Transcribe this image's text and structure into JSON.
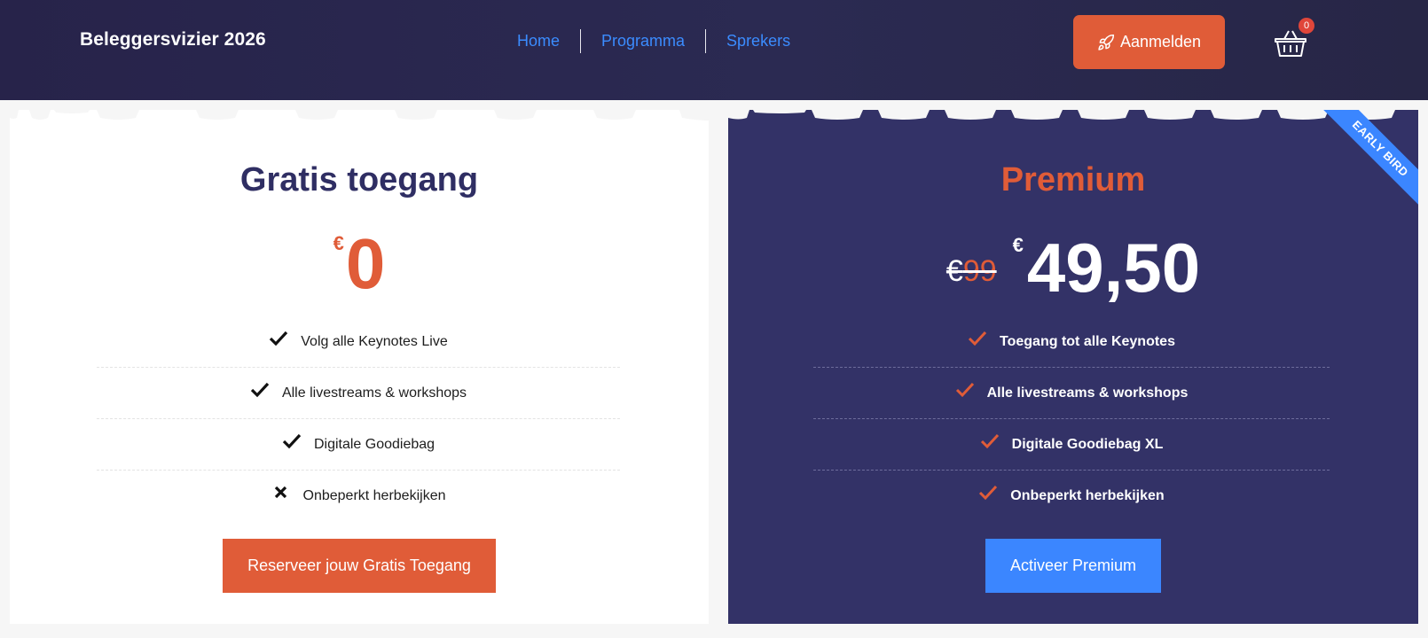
{
  "header": {
    "brand": "Beleggersvizier 2026",
    "nav": [
      "Home",
      "Programma",
      "Sprekers"
    ],
    "signup_label": "Aanmelden",
    "cart_count": "0"
  },
  "plans": {
    "free": {
      "title": "Gratis toegang",
      "currency": "€",
      "price": "0",
      "features": [
        {
          "text": "Volg alle Keynotes Live",
          "icon": "check-icon"
        },
        {
          "text": "Alle livestreams & workshops",
          "icon": "check-icon"
        },
        {
          "text": "Digitale Goodiebag",
          "icon": "check-icon"
        },
        {
          "text": "Onbeperkt herbekijken",
          "icon": "cross-icon"
        }
      ],
      "cta": "Reserveer jouw Gratis Toegang"
    },
    "premium": {
      "title": "Premium",
      "old_currency": "€",
      "old_price": "99",
      "currency": "€",
      "price": "49,50",
      "ribbon": "EARLY BIRD",
      "features": [
        {
          "text": "Toegang tot alle Keynotes",
          "icon": "check-icon"
        },
        {
          "text": "Alle livestreams & workshops",
          "icon": "check-icon"
        },
        {
          "text": "Digitale Goodiebag XL",
          "icon": "check-icon"
        },
        {
          "text": "Onbeperkt herbekijken",
          "icon": "check-icon"
        }
      ],
      "cta": "Activeer Premium"
    }
  },
  "colors": {
    "header_bg": "#29264d",
    "accent_orange": "#e05c38",
    "accent_blue": "#3b86ff",
    "premium_bg": "#333267"
  }
}
